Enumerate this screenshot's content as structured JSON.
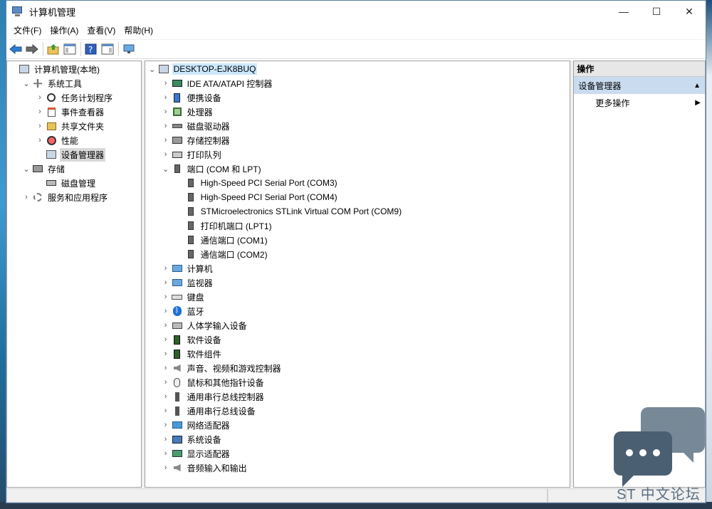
{
  "window": {
    "title": "计算机管理"
  },
  "window_controls": [
    "—",
    "☐",
    "✕"
  ],
  "menubar": [
    "文件(F)",
    "操作(A)",
    "查看(V)",
    "帮助(H)"
  ],
  "left_tree": [
    {
      "label": "计算机管理(本地)",
      "level": 0,
      "chev": "",
      "icon": "i-comp"
    },
    {
      "label": "系统工具",
      "level": 1,
      "chev": "⌄",
      "icon": "i-tool"
    },
    {
      "label": "任务计划程序",
      "level": 2,
      "chev": "›",
      "icon": "i-clock"
    },
    {
      "label": "事件查看器",
      "level": 2,
      "chev": "›",
      "icon": "i-log"
    },
    {
      "label": "共享文件夹",
      "level": 2,
      "chev": "›",
      "icon": "i-share"
    },
    {
      "label": "性能",
      "level": 2,
      "chev": "›",
      "icon": "i-perf"
    },
    {
      "label": "设备管理器",
      "level": 2,
      "chev": "",
      "icon": "i-comp",
      "selected": true
    },
    {
      "label": "存储",
      "level": 1,
      "chev": "⌄",
      "icon": "i-store"
    },
    {
      "label": "磁盘管理",
      "level": 2,
      "chev": "",
      "icon": "i-disk"
    },
    {
      "label": "服务和应用程序",
      "level": 1,
      "chev": "›",
      "icon": "i-gear"
    }
  ],
  "device_tree": [
    {
      "label": "DESKTOP-EJK8BUQ",
      "level": 0,
      "chev": "⌄",
      "icon": "i-comp",
      "root": true
    },
    {
      "label": "IDE ATA/ATAPI 控制器",
      "level": 1,
      "chev": "›",
      "icon": "i-ide"
    },
    {
      "label": "便携设备",
      "level": 1,
      "chev": "›",
      "icon": "i-portable"
    },
    {
      "label": "处理器",
      "level": 1,
      "chev": "›",
      "icon": "i-chip"
    },
    {
      "label": "磁盘驱动器",
      "level": 1,
      "chev": "›",
      "icon": "i-drive"
    },
    {
      "label": "存储控制器",
      "level": 1,
      "chev": "›",
      "icon": "i-store"
    },
    {
      "label": "打印队列",
      "level": 1,
      "chev": "›",
      "icon": "i-print"
    },
    {
      "label": "端口 (COM 和 LPT)",
      "level": 1,
      "chev": "⌄",
      "icon": "i-port"
    },
    {
      "label": "High-Speed PCI Serial Port (COM3)",
      "level": 2,
      "chev": "",
      "icon": "i-port"
    },
    {
      "label": "High-Speed PCI Serial Port (COM4)",
      "level": 2,
      "chev": "",
      "icon": "i-port"
    },
    {
      "label": "STMicroelectronics STLink Virtual COM Port (COM9)",
      "level": 2,
      "chev": "",
      "icon": "i-port"
    },
    {
      "label": "打印机端口 (LPT1)",
      "level": 2,
      "chev": "",
      "icon": "i-port"
    },
    {
      "label": "通信端口 (COM1)",
      "level": 2,
      "chev": "",
      "icon": "i-port"
    },
    {
      "label": "通信端口 (COM2)",
      "level": 2,
      "chev": "",
      "icon": "i-port"
    },
    {
      "label": "计算机",
      "level": 1,
      "chev": "›",
      "icon": "i-mon"
    },
    {
      "label": "监视器",
      "level": 1,
      "chev": "›",
      "icon": "i-mon"
    },
    {
      "label": "键盘",
      "level": 1,
      "chev": "›",
      "icon": "i-kbd"
    },
    {
      "label": "蓝牙",
      "level": 1,
      "chev": "›",
      "icon": "i-bt"
    },
    {
      "label": "人体学输入设备",
      "level": 1,
      "chev": "›",
      "icon": "i-hid"
    },
    {
      "label": "软件设备",
      "level": 1,
      "chev": "›",
      "icon": "i-soft"
    },
    {
      "label": "软件组件",
      "level": 1,
      "chev": "›",
      "icon": "i-soft"
    },
    {
      "label": "声音、视频和游戏控制器",
      "level": 1,
      "chev": "›",
      "icon": "i-spk"
    },
    {
      "label": "鼠标和其他指针设备",
      "level": 1,
      "chev": "›",
      "icon": "i-mouse"
    },
    {
      "label": "通用串行总线控制器",
      "level": 1,
      "chev": "›",
      "icon": "i-usb"
    },
    {
      "label": "通用串行总线设备",
      "level": 1,
      "chev": "›",
      "icon": "i-usb"
    },
    {
      "label": "网络适配器",
      "level": 1,
      "chev": "›",
      "icon": "i-net"
    },
    {
      "label": "系统设备",
      "level": 1,
      "chev": "›",
      "icon": "i-sys"
    },
    {
      "label": "显示适配器",
      "level": 1,
      "chev": "›",
      "icon": "i-display"
    },
    {
      "label": "音频输入和输出",
      "level": 1,
      "chev": "›",
      "icon": "i-spk"
    }
  ],
  "actions": {
    "header": "操作",
    "section": "设备管理器",
    "section_arrow": "▲",
    "item": "更多操作",
    "item_arrow": "▶"
  },
  "watermark": {
    "text": "ST 中文论坛"
  }
}
